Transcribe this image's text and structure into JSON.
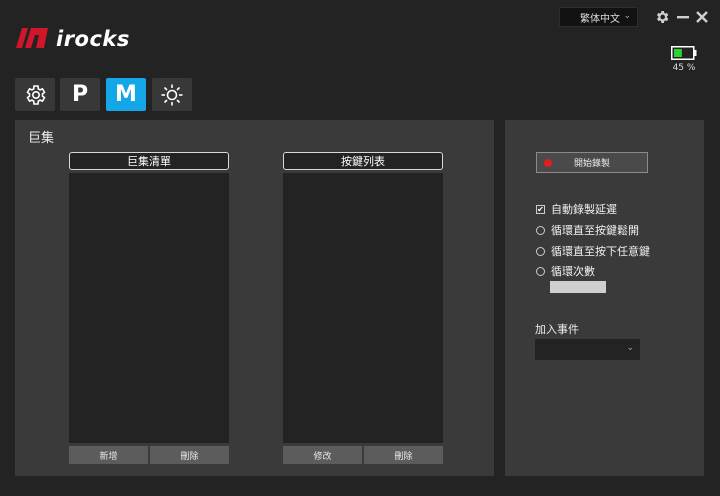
{
  "header": {
    "brand": "irocks",
    "language": "繁体中文",
    "battery_level": 0.45,
    "battery_text": "45 %"
  },
  "tabs": [
    {
      "name": "settings",
      "label": "",
      "icon": "gear-icon",
      "active": false
    },
    {
      "name": "profile",
      "label": "P",
      "active": false
    },
    {
      "name": "macro",
      "label": "M",
      "active": true
    },
    {
      "name": "lighting",
      "label": "",
      "icon": "sun-icon",
      "active": false
    }
  ],
  "macro": {
    "section_title": "巨集",
    "macro_list": {
      "header": "巨集清單",
      "items": [],
      "add_label": "新增",
      "delete_label": "刪除"
    },
    "key_list": {
      "header": "按鍵列表",
      "items": [],
      "edit_label": "修改",
      "delete_label": "刪除"
    }
  },
  "recording": {
    "start_label": "開始錄製",
    "auto_delay_label": "自動錄製延遲",
    "auto_delay_checked": true,
    "options": [
      {
        "label": "循環直至按鍵鬆開",
        "selected": false
      },
      {
        "label": "循環直至按下任意鍵",
        "selected": false
      },
      {
        "label": "循環次數",
        "selected": false
      }
    ],
    "loop_count_value": "",
    "add_event_label": "加入事件",
    "add_event_value": ""
  },
  "colors": {
    "accent": "#14a7e8",
    "record_dot": "#e01e1e",
    "brand_red": "#d0162b"
  }
}
